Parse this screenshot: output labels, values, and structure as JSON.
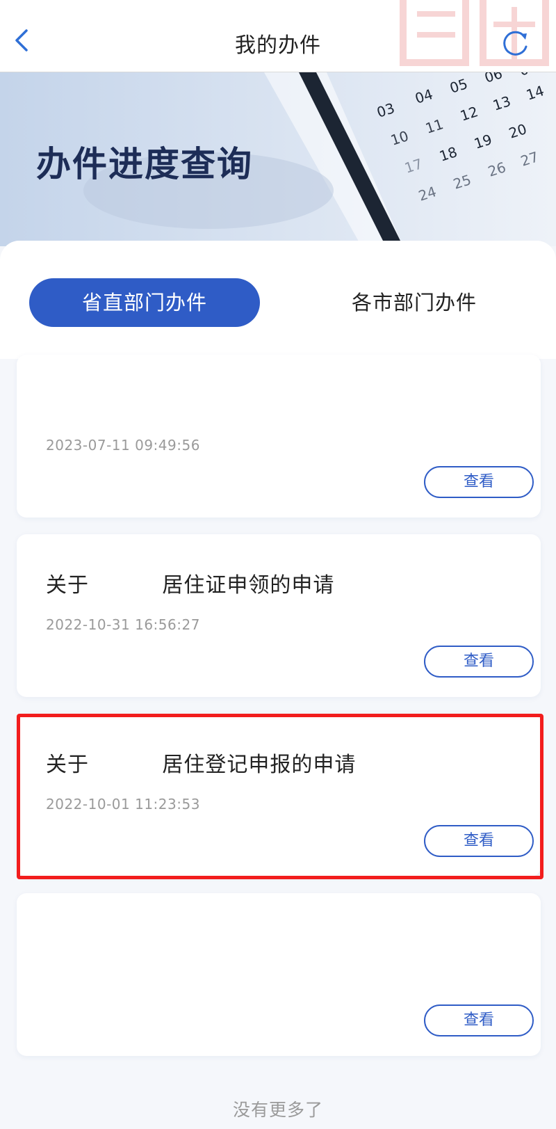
{
  "nav": {
    "title": "我的办件"
  },
  "banner": {
    "title": "办件进度查询"
  },
  "tabs": [
    {
      "label": "省直部门办件",
      "active": true
    },
    {
      "label": "各市部门办件",
      "active": false
    }
  ],
  "cards": [
    {
      "title": "",
      "date": "2023-07-11 09:49:56",
      "button": "查看"
    },
    {
      "title": "关于          居住证申领的申请",
      "date": "2022-10-31 16:56:27",
      "button": "查看"
    },
    {
      "title": "关于          居住登记申报的申请",
      "date": "2022-10-01 11:23:53",
      "button": "查看",
      "highlighted": true
    },
    {
      "title": "",
      "date": "",
      "button": "查看"
    }
  ],
  "footer": {
    "text": "没有更多了"
  },
  "colors": {
    "accent": "#2f5cc6",
    "highlight": "#f21d1d"
  },
  "icons": {
    "back": "chevron-left-icon",
    "refresh": "refresh-icon"
  }
}
